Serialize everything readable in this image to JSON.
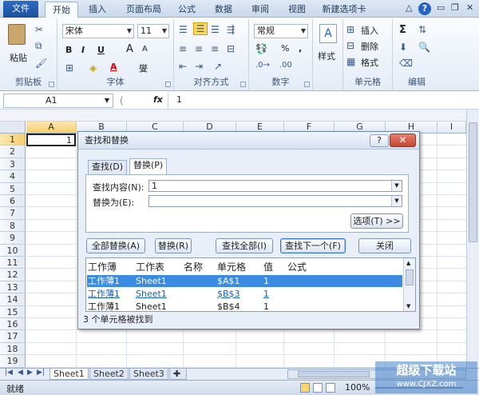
{
  "tabs": {
    "file": "文件",
    "home": "开始",
    "insert": "插入",
    "layout": "页面布局",
    "formulas": "公式",
    "data": "数据",
    "review": "审阅",
    "view": "视图",
    "newtab": "新建选项卡"
  },
  "ribbon": {
    "clipboard": {
      "label": "剪贴板",
      "paste": "粘贴"
    },
    "font": {
      "label": "字体",
      "name": "宋体",
      "size": "11",
      "bold": "B",
      "italic": "I",
      "underline": "U",
      "grow": "A",
      "shrink": "A",
      "color_letter": "A",
      "phonetic": "燮"
    },
    "align": {
      "label": "对齐方式"
    },
    "number": {
      "label": "数字",
      "format": "常规",
      "percent": "%",
      "comma": ","
    },
    "styles": {
      "label": "样式"
    },
    "cells": {
      "label": "单元格",
      "insert": "插入",
      "delete": "删除",
      "format": "格式"
    },
    "editing": {
      "label": "编辑",
      "sigma": "Σ"
    }
  },
  "formula_bar": {
    "namebox": "A1",
    "fx": "fx",
    "content": "1"
  },
  "columns": [
    "A",
    "B",
    "C",
    "D",
    "E",
    "F",
    "G",
    "H",
    "I"
  ],
  "rows": [
    "1",
    "2",
    "3",
    "4",
    "5",
    "6",
    "7",
    "8",
    "9",
    "10",
    "11",
    "12",
    "13",
    "14",
    "15",
    "16",
    "17",
    "18",
    "19"
  ],
  "cell_a1": "1",
  "dialog": {
    "title": "查找和替换",
    "help": "?",
    "close": "✕",
    "tab_find": "查找(D)",
    "tab_replace": "替换(P)",
    "find_label": "查找内容(N):",
    "find_value": "1",
    "replace_label": "替换为(E):",
    "replace_value": "",
    "options": "选项(T) >>",
    "replace_all": "全部替换(A)",
    "replace": "替换(R)",
    "find_all": "查找全部(I)",
    "find_next": "查找下一个(F)",
    "close_btn": "关闭",
    "result_headers": [
      "工作薄",
      "工作表",
      "名称",
      "单元格",
      "值",
      "公式"
    ],
    "results": [
      {
        "book": "工作薄1",
        "sheet": "Sheet1",
        "cell": "$A$1",
        "value": "1"
      },
      {
        "book": "工作薄1",
        "sheet": "Sheet1",
        "cell": "$B$3",
        "value": "1"
      },
      {
        "book": "工作薄1",
        "sheet": "Sheet1",
        "cell": "$B$4",
        "value": "1"
      }
    ],
    "status": "3 个单元格被找到"
  },
  "sheets": [
    "Sheet1",
    "Sheet2",
    "Sheet3"
  ],
  "status": {
    "ready": "就绪",
    "zoom": "100%"
  },
  "watermark": "超级下载站",
  "watermark_url": "www.CJXZ.com"
}
